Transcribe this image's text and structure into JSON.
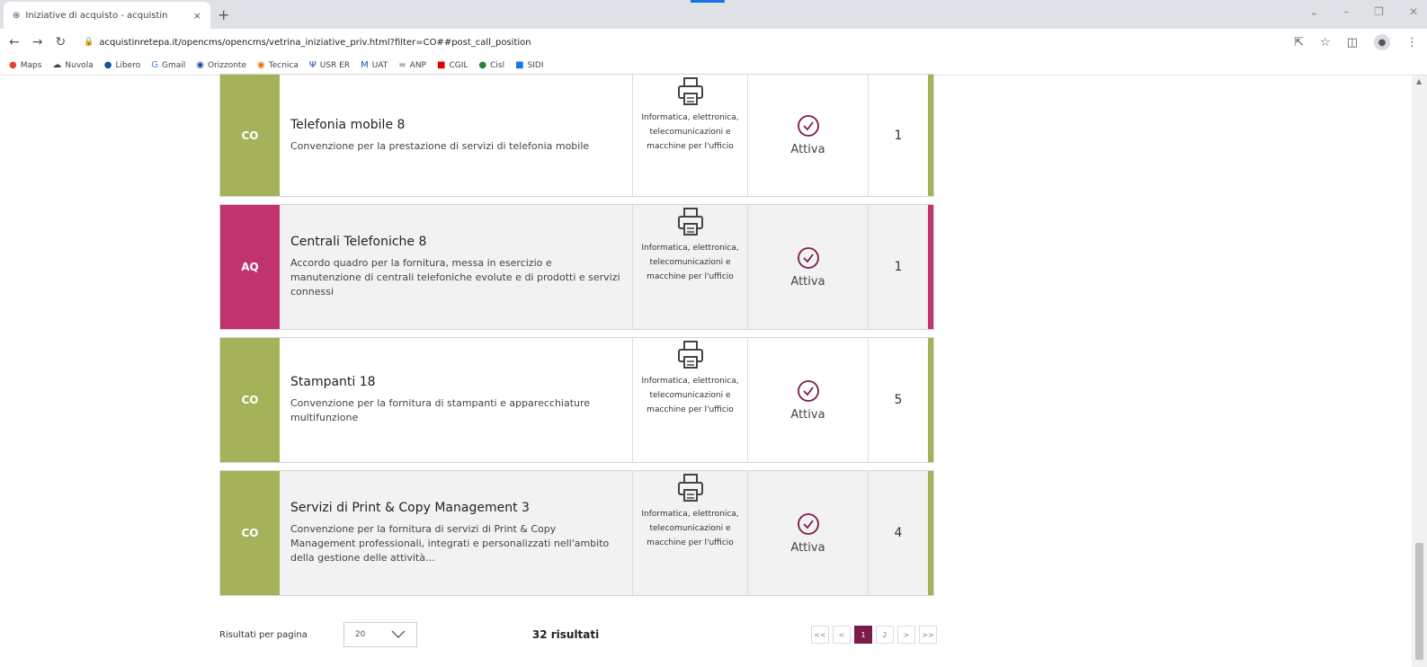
{
  "browser": {
    "tab_title": "Iniziative di acquisto - acquistin",
    "tab_close": "×",
    "new_tab": "+",
    "url": "acquistinretepa.it/opencms/opencms/vetrina_iniziative_priv.html?filter=CO##post_call_position",
    "bookmarks": [
      "Maps",
      "Nuvola",
      "Libero",
      "Gmail",
      "Orizzonte",
      "Tecnica",
      "USR ER",
      "UAT",
      "ANP",
      "CGIL",
      "Cisl",
      "SIDI"
    ]
  },
  "initiatives": [
    {
      "badge": "CO",
      "title": "Telefonia mobile 8",
      "description": "Convenzione per la prestazione di servizi di telefonia mobile",
      "category": "Informatica, elettronica, telecomunicazioni e macchine per l'ufficio",
      "status": "Attiva",
      "count": "1"
    },
    {
      "badge": "AQ",
      "title": "Centrali Telefoniche 8",
      "description": "Accordo quadro per la fornitura, messa in esercizio e manutenzione di centrali telefoniche evolute e di prodotti e servizi connessi",
      "category": "Informatica, elettronica, telecomunicazioni e macchine per l'ufficio",
      "status": "Attiva",
      "count": "1"
    },
    {
      "badge": "CO",
      "title": "Stampanti 18",
      "description": "Convenzione per la fornitura di stampanti e apparecchiature multifunzione",
      "category": "Informatica, elettronica, telecomunicazioni e macchine per l'ufficio",
      "status": "Attiva",
      "count": "5"
    },
    {
      "badge": "CO",
      "title": "Servizi di Print & Copy Management 3",
      "description": "Convenzione per la fornitura di servizi di Print & Copy Management professionali, integrati e personalizzati nell'ambito della gestione delle attività...",
      "category": "Informatica, elettronica, telecomunicazioni e macchine per l'ufficio",
      "status": "Attiva",
      "count": "4"
    }
  ],
  "pager": {
    "per_page_label": "Risultati per pagina",
    "per_page_value": "20",
    "results": "32 risultati",
    "pages": [
      "<<",
      "<",
      "1",
      "2",
      ">",
      ">>"
    ]
  },
  "colors": {
    "co": "#a5b25a",
    "aq": "#c0336e",
    "accent": "#7c1a49"
  }
}
